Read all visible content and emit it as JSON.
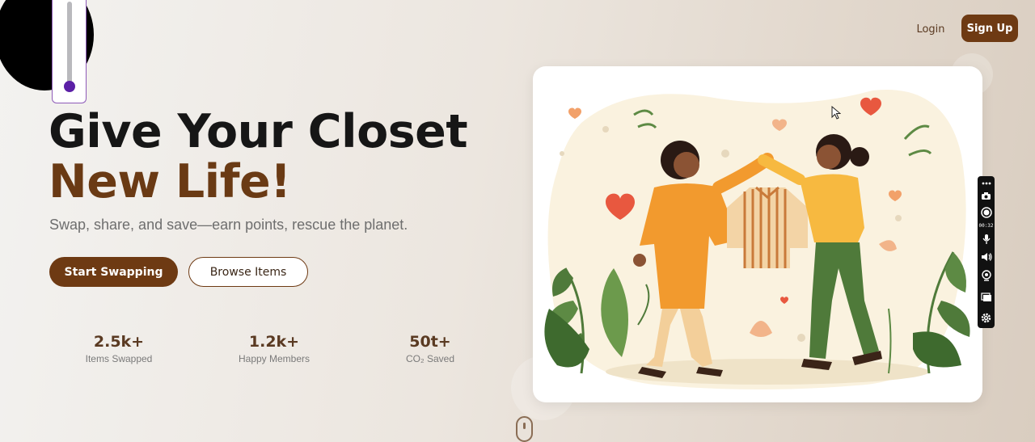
{
  "nav": {
    "login": "Login",
    "signup": "Sign Up"
  },
  "hero": {
    "title_line1": "Give Your Closet",
    "title_line2": "New Life!",
    "subtitle": "Swap, share, and save—earn points, rescue the planet.",
    "primary_cta": "Start Swapping",
    "secondary_cta": "Browse Items"
  },
  "stats": [
    {
      "value": "2.5k+",
      "label": "Items Swapped"
    },
    {
      "value": "1.2k+",
      "label": "Happy Members"
    },
    {
      "value": "50t+",
      "label": "CO₂ Saved"
    }
  ],
  "recorder": {
    "timer": "00:32"
  },
  "illustration": {
    "subject": "two people exchanging a striped shirt among leaves and hearts"
  },
  "colors": {
    "brand_brown": "#6e3a13",
    "title_dark": "#161616",
    "accent_orange": "#f29a2e",
    "leaf_green": "#4f7a3a",
    "heart_red": "#e8583f"
  }
}
